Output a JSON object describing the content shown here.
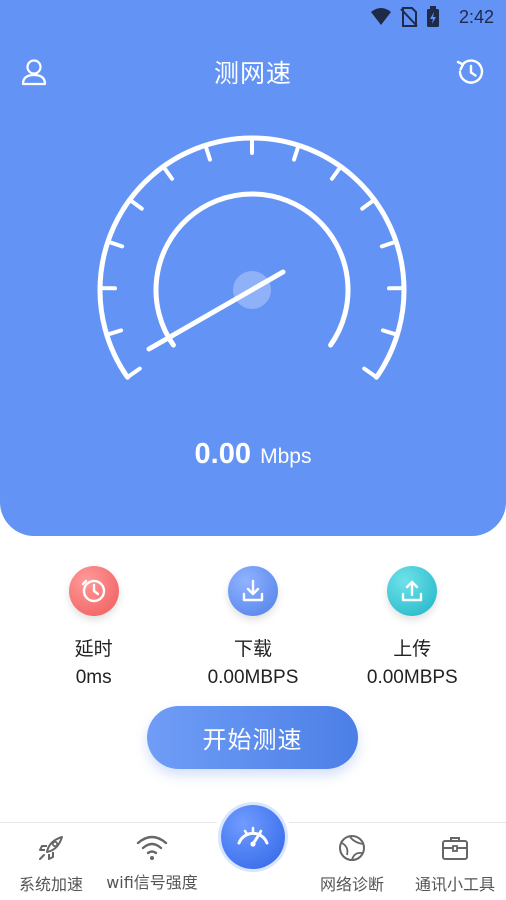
{
  "status_bar": {
    "time": "2:42",
    "icons": [
      "wifi-icon",
      "no-sim-icon",
      "battery-charging-icon"
    ]
  },
  "header": {
    "title": "测网速",
    "left_icon": "user-icon",
    "right_icon": "history-icon"
  },
  "gauge": {
    "speed_value": "0.00",
    "speed_unit": "Mbps",
    "needle_level": 0.5
  },
  "stats": [
    {
      "icon": "timer-icon",
      "label": "延时",
      "value": "0ms",
      "color": "#ef5a5a"
    },
    {
      "icon": "download-icon",
      "label": "下载",
      "value": "0.00MBPS",
      "color": "#4f7fe8"
    },
    {
      "icon": "upload-icon",
      "label": "上传",
      "value": "0.00MBPS",
      "color": "#1fb3c6"
    }
  ],
  "start_button": {
    "label": "开始测速"
  },
  "bottom_nav": [
    {
      "icon": "rocket-icon",
      "label": "系统加速"
    },
    {
      "icon": "wifi-signal-icon",
      "label": "wifi信号强度"
    },
    {
      "icon": "speedometer-icon",
      "label": ""
    },
    {
      "icon": "globe-icon",
      "label": "网络诊断"
    },
    {
      "icon": "toolbox-icon",
      "label": "通讯小工具"
    }
  ],
  "colors": {
    "primary": "#6394f5",
    "accent": "#4c7fe6",
    "white": "#ffffff"
  }
}
